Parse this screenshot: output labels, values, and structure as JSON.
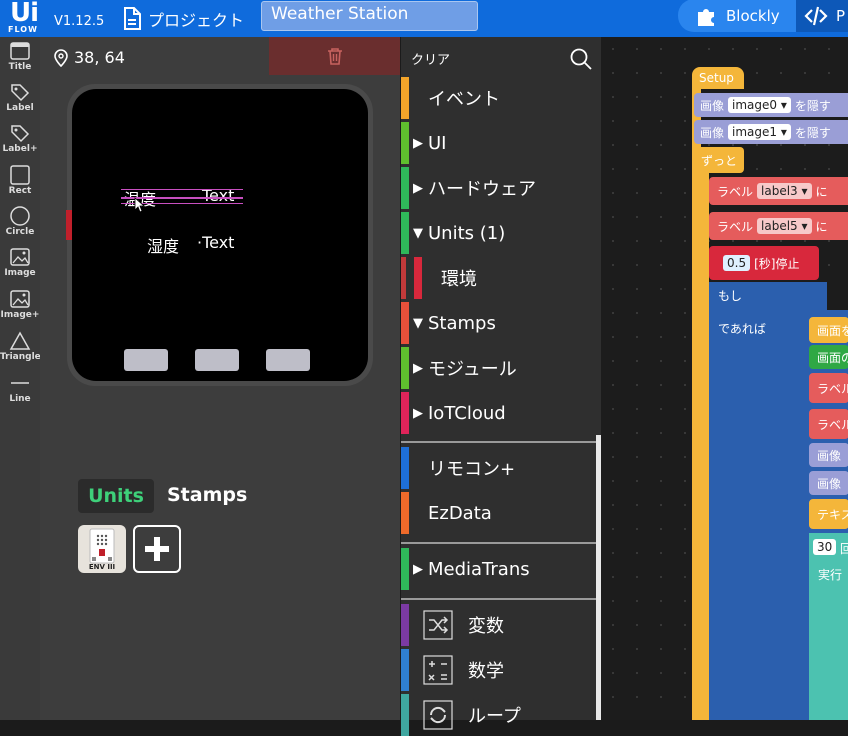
{
  "app": {
    "logo_top": "Ui",
    "logo_bottom": "FLOW",
    "version": "V1.12.5",
    "project_label": "プロジェクト",
    "project_title": "Weather Station",
    "blockly_tab": "Blockly",
    "python_tab_partial": "P"
  },
  "tools": [
    {
      "label": "Title",
      "icon": "title-icon"
    },
    {
      "label": "Label",
      "icon": "label-tag-icon"
    },
    {
      "label": "Label+",
      "icon": "label-plus-icon"
    },
    {
      "label": "Rect",
      "icon": "rect-icon"
    },
    {
      "label": "Circle",
      "icon": "circle-icon"
    },
    {
      "label": "Image",
      "icon": "image-icon"
    },
    {
      "label": "Image+",
      "icon": "image-plus-icon"
    },
    {
      "label": "Triangle",
      "icon": "triangle-icon"
    },
    {
      "label": "Line",
      "icon": "line-icon"
    }
  ],
  "simulator": {
    "coords": "38, 64",
    "screen_labels": [
      {
        "text": "温度"
      },
      {
        "text": "Text"
      },
      {
        "text": "湿度"
      },
      {
        "text": "·Text"
      }
    ],
    "tabs": {
      "units": "Units",
      "stamps": "Stamps"
    },
    "env_unit_label": "ENV III"
  },
  "categories": {
    "clear": "クリア",
    "items": [
      {
        "label": "イベント",
        "color": "#f3a52a",
        "arrow": ""
      },
      {
        "label": "UI",
        "color": "#5fbf2e",
        "arrow": "▶"
      },
      {
        "label": "ハードウェア",
        "color": "#2fb85a",
        "arrow": "▶"
      },
      {
        "label": "Units (1)",
        "color": "#2fb85a",
        "arrow": "▼"
      },
      {
        "label": "環境",
        "color": "#d8283c",
        "arrow": ""
      },
      {
        "label": "Stamps",
        "color": "#e8503a",
        "arrow": "▼"
      },
      {
        "label": "モジュール",
        "color": "#5fbf2e",
        "arrow": "▶"
      },
      {
        "label": "IoTCloud",
        "color": "#e0245a",
        "arrow": "▶"
      },
      {
        "label": "リモコン+",
        "color": "#1e6fd8",
        "arrow": ""
      },
      {
        "label": "EzData",
        "color": "#ee6a2a",
        "arrow": ""
      },
      {
        "label": "MediaTrans",
        "color": "#2fb85a",
        "arrow": "▶"
      },
      {
        "label": "変数",
        "color": "#7b3aa3",
        "arrow": ""
      },
      {
        "label": "数学",
        "color": "#2f7fd0",
        "arrow": ""
      },
      {
        "label": "ループ",
        "color": "#3fa7a0",
        "arrow": ""
      }
    ]
  },
  "blocks": {
    "setup": "Setup",
    "image_prefix": "画像",
    "image0": "image0",
    "image1": "image1",
    "hide": "を隠す",
    "forever": "ずっと",
    "label_prefix": "ラベル",
    "label3": "label3",
    "label5": "label5",
    "ni": "に",
    "wait_value": "0.5",
    "wait_label": "[秒]停止",
    "if": "もし",
    "then": "であれば",
    "partial_screen1": "画面を",
    "partial_screen2": "画面の",
    "partial_label": "ラベル",
    "partial_image": "画像",
    "partial_text": "テキス",
    "repeat_value": "30",
    "partial_repeat": "回",
    "do": "実行"
  }
}
